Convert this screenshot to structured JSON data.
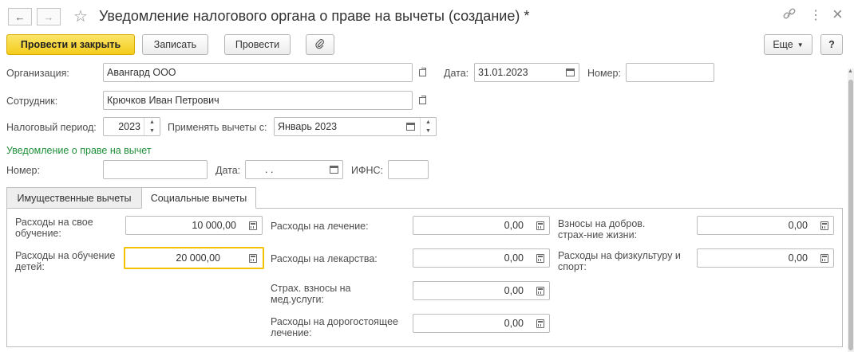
{
  "window": {
    "title": "Уведомление налогового органа о праве на вычеты (создание) *",
    "nav_back": "←",
    "nav_forward": "→",
    "star": "☆",
    "link": "🔗",
    "more": "⋮",
    "close": "×"
  },
  "toolbar": {
    "post_close": "Провести и закрыть",
    "save": "Записать",
    "post": "Провести",
    "more": "Еще",
    "help": "?"
  },
  "header": {
    "org_label": "Организация:",
    "org_value": "Авангард ООО",
    "date_label": "Дата:",
    "date_value": "31.01.2023",
    "number_label": "Номер:",
    "number_value": "",
    "employee_label": "Сотрудник:",
    "employee_value": "Крючков Иван Петрович",
    "period_label": "Налоговый период:",
    "period_value": "2023",
    "apply_label": "Применять вычеты с:",
    "apply_value": "Январь 2023"
  },
  "notice": {
    "section_title": "Уведомление о праве на вычет",
    "number_label": "Номер:",
    "number_value": "",
    "date_label": "Дата:",
    "date_value": " .  .",
    "ifns_label": "ИФНС:",
    "ifns_value": ""
  },
  "tabs": [
    {
      "label": "Имущественные вычеты",
      "active": false
    },
    {
      "label": "Социальные вычеты",
      "active": true
    }
  ],
  "social": {
    "education_label": "Расходы на свое обучение:",
    "education_value": "10 000,00",
    "children_label": "Расходы на обучение детей:",
    "children_value": "20 000,00",
    "treatment_label": "Расходы на лечение:",
    "treatment_value": "0,00",
    "medicine_label": "Расходы на лекарства:",
    "medicine_value": "0,00",
    "insurance_label": "Страх. взносы на мед.услуги:",
    "insurance_value": "0,00",
    "expensive_label": "Расходы на дорогостоящее лечение:",
    "expensive_value": "0,00",
    "life_label": "Взносы на добров. страх-ние жизни:",
    "life_value": "0,00",
    "sport_label": "Расходы на физкультуру и спорт:",
    "sport_value": "0,00"
  }
}
